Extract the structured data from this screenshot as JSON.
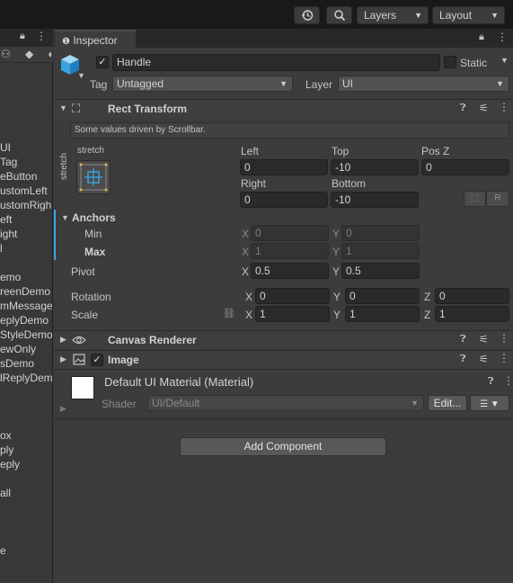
{
  "toolbar": {
    "history_icon": "history-icon",
    "search_icon": "search-icon",
    "layers_label": "Layers",
    "layout_label": "Layout"
  },
  "hierarchy": {
    "items": [
      "UI",
      "Tag",
      "eButton",
      "ustomLeft",
      "ustomRigh",
      "eft",
      "ight",
      "l",
      "emo",
      "reenDemo",
      "mMessage",
      "eplyDemo",
      "StyleDemo",
      "ewOnly",
      "sDemo",
      "lReplyDem",
      "ox",
      "ply",
      "eply",
      "all",
      "e"
    ]
  },
  "inspector": {
    "tab_label": "Inspector",
    "object_name": "Handle",
    "static_label": "Static",
    "tag_label": "Tag",
    "tag_value": "Untagged",
    "layer_label": "Layer",
    "layer_value": "UI"
  },
  "rect_transform": {
    "title": "Rect Transform",
    "notice": "Some values driven by Scrollbar.",
    "anchor_preset_h": "stretch",
    "anchor_preset_v": "stretch",
    "left_label": "Left",
    "left_value": "0",
    "top_label": "Top",
    "top_value": "-10",
    "posz_label": "Pos Z",
    "posz_value": "0",
    "right_label": "Right",
    "right_value": "0",
    "bottom_label": "Bottom",
    "bottom_value": "-10",
    "r_button": "R",
    "anchors_label": "Anchors",
    "min_label": "Min",
    "min_x": "0",
    "min_y": "0",
    "max_label": "Max",
    "max_x": "1",
    "max_y": "1",
    "pivot_label": "Pivot",
    "pivot_x": "0.5",
    "pivot_y": "0.5",
    "rotation_label": "Rotation",
    "rot_x": "0",
    "rot_y": "0",
    "rot_z": "0",
    "scale_label": "Scale",
    "scale_x": "1",
    "scale_y": "1",
    "scale_z": "1",
    "x": "X",
    "y": "Y",
    "z": "Z"
  },
  "canvas_renderer": {
    "title": "Canvas Renderer"
  },
  "image": {
    "title": "Image"
  },
  "material": {
    "name": "Default UI Material (Material)",
    "shader_label": "Shader",
    "shader_value": "UI/Default",
    "edit_button": "Edit..."
  },
  "add_component": "Add Component"
}
